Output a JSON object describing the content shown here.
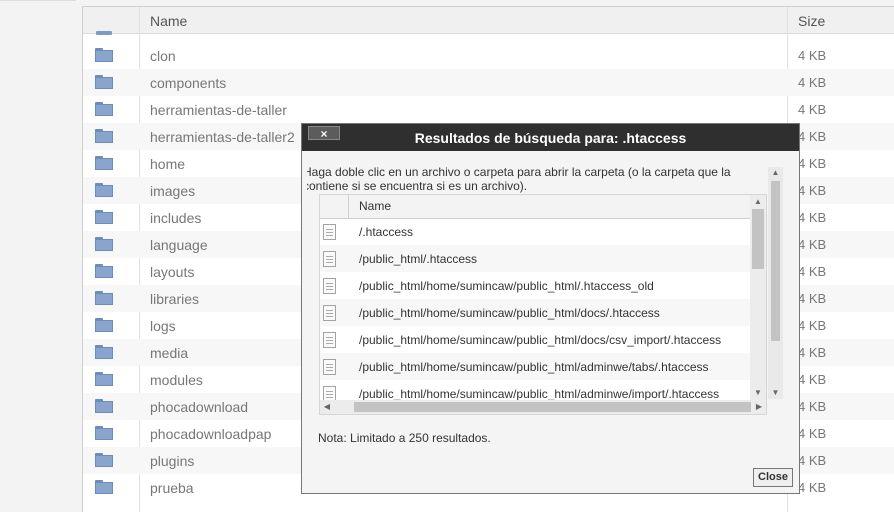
{
  "file_manager": {
    "columns": {
      "name": "Name",
      "size": "Size"
    },
    "rows": [
      {
        "name": "clon",
        "size": "4 KB"
      },
      {
        "name": "components",
        "size": "4 KB"
      },
      {
        "name": "herramientas-de-taller",
        "size": "4 KB"
      },
      {
        "name": "herramientas-de-taller2",
        "size": "4 KB"
      },
      {
        "name": "home",
        "size": "4 KB"
      },
      {
        "name": "images",
        "size": "4 KB"
      },
      {
        "name": "includes",
        "size": "4 KB"
      },
      {
        "name": "language",
        "size": "4 KB"
      },
      {
        "name": "layouts",
        "size": "4 KB"
      },
      {
        "name": "libraries",
        "size": "4 KB"
      },
      {
        "name": "logs",
        "size": "4 KB"
      },
      {
        "name": "media",
        "size": "4 KB"
      },
      {
        "name": "modules",
        "size": "4 KB"
      },
      {
        "name": "phocadownload",
        "size": "4 KB"
      },
      {
        "name": "phocadownloadpap",
        "size": "4 KB"
      },
      {
        "name": "plugins",
        "size": "4 KB"
      },
      {
        "name": "prueba",
        "size": "4 KB"
      }
    ]
  },
  "dialog": {
    "close_x": "×",
    "title": "Resultados de búsqueda para: .htaccess",
    "instructions": "Haga doble clic en un archivo o carpeta para abrir la carpeta (o la carpeta que la contiene si se encuentra si es un archivo).",
    "results_column": "Name",
    "results": [
      "/.htaccess",
      "/public_html/.htaccess",
      "/public_html/home/sumincaw/public_html/.htaccess_old",
      "/public_html/home/sumincaw/public_html/docs/.htaccess",
      "/public_html/home/sumincaw/public_html/docs/csv_import/.htaccess",
      "/public_html/home/sumincaw/public_html/adminwe/tabs/.htaccess",
      "/public_html/home/sumincaw/public_html/adminwe/import/.htaccess"
    ],
    "note": "Nota: Limitado a 250 resultados.",
    "close_button": "Close"
  },
  "icons": {
    "folder": "folder-icon",
    "file": "document-icon",
    "scroll_up": "▲",
    "scroll_down": "▼",
    "scroll_left": "◀",
    "scroll_right": "▶"
  },
  "colors": {
    "titlebar": "#2f2f2f",
    "folder": "#8aa5cd"
  }
}
